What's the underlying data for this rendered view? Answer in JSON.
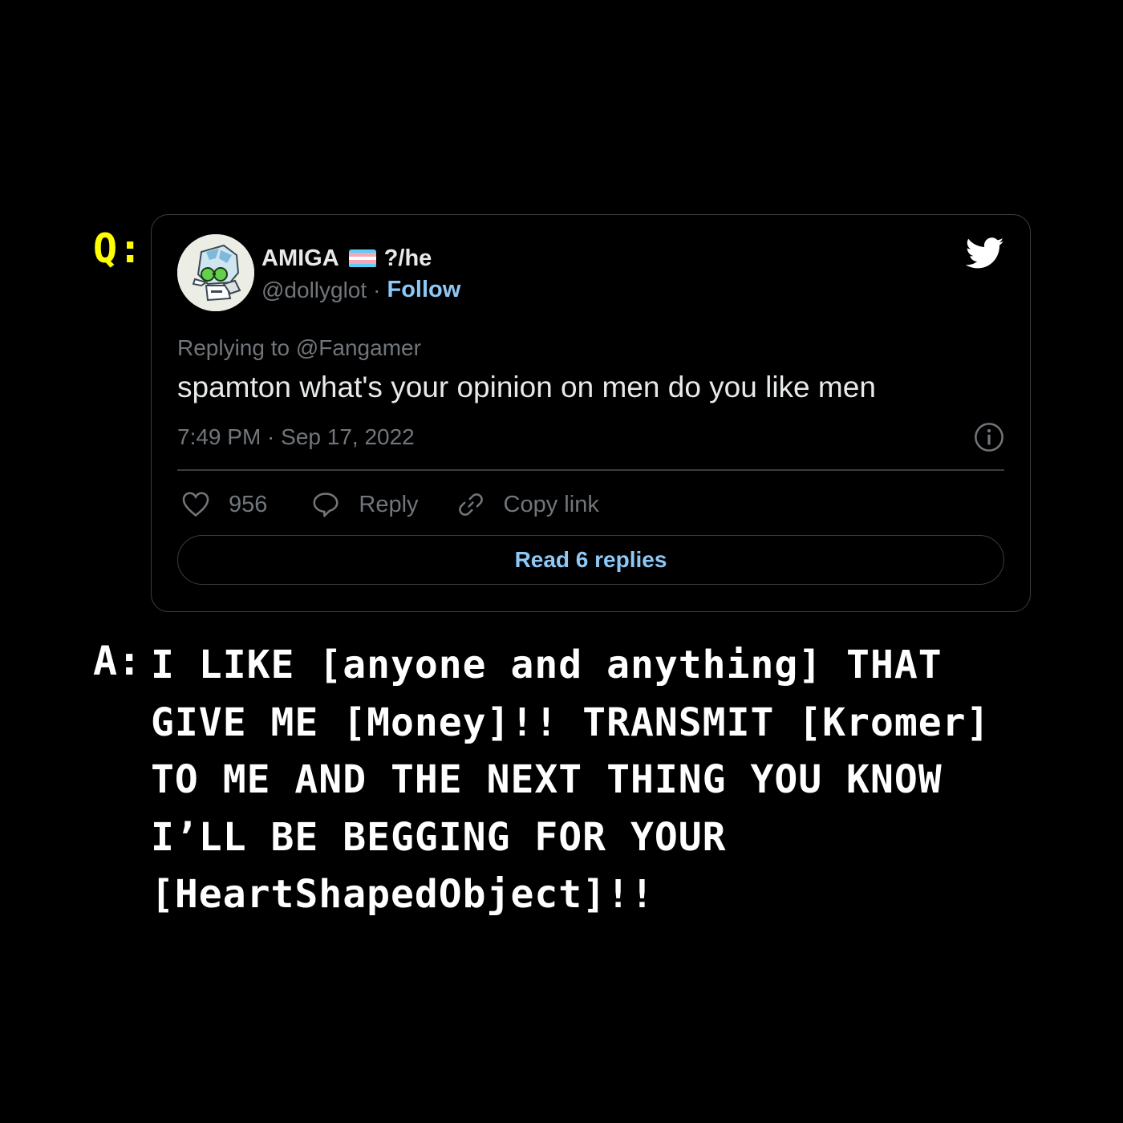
{
  "question_label": "Q:",
  "answer_label": "A:",
  "tweet": {
    "display_name": "AMIGA",
    "pronouns": "?/he",
    "handle": "@dollyglot",
    "separator": "·",
    "follow_label": "Follow",
    "replying_prefix": "Replying to",
    "replying_to": "@Fangamer",
    "text": "spamton what's your opinion on men do you like men",
    "timestamp": "7:49 PM · Sep 17, 2022",
    "like_count": "956",
    "reply_label": "Reply",
    "copy_link_label": "Copy link",
    "read_replies_label": "Read 6 replies",
    "flag_colors": [
      "#5bcefa",
      "#f5a9b8",
      "#ffffff",
      "#f5a9b8",
      "#5bcefa"
    ],
    "icons": {
      "brand": "twitter-bird-icon",
      "info": "info-icon",
      "like": "heart-icon",
      "reply": "speech-bubble-icon",
      "copy": "link-icon"
    }
  },
  "answer_text": "I LIKE [anyone and anything] THAT GIVE ME [Money]!! TRANSMIT [Kromer] TO ME AND THE NEXT THING YOU KNOW I’LL BE BEGGING FOR YOUR [HeartShapedObject]!!",
  "colors": {
    "background": "#000000",
    "question_label": "#ffff00",
    "link_blue": "#8ec8f6",
    "muted": "#71767b"
  }
}
